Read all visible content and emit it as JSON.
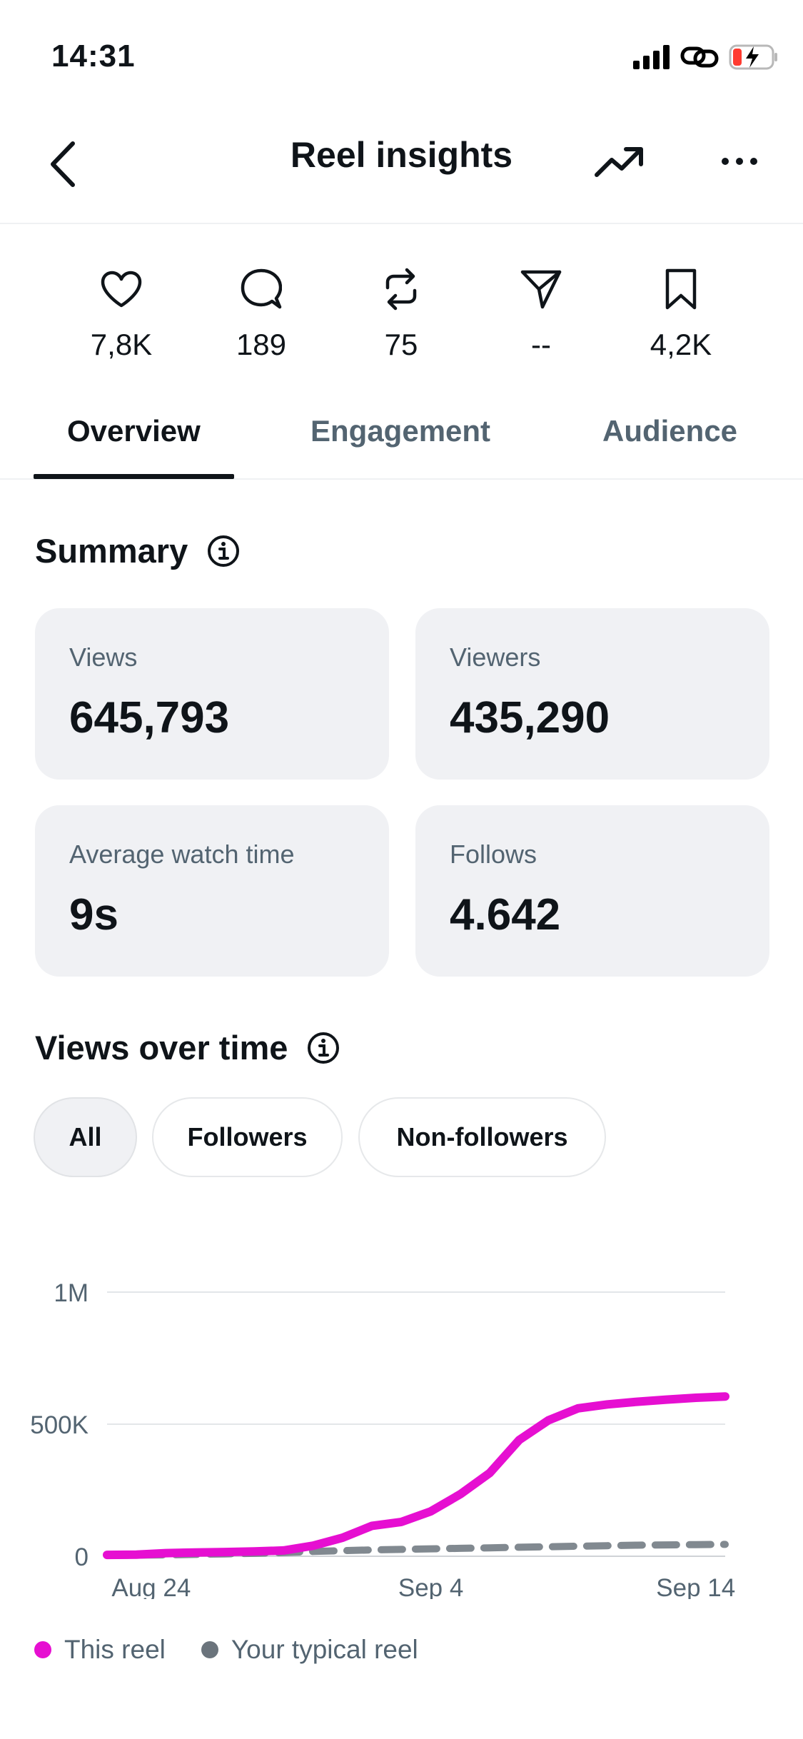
{
  "status_bar": {
    "time": "14:31"
  },
  "header": {
    "title": "Reel insights"
  },
  "stats": [
    {
      "icon": "heart-icon",
      "value": "7,8K"
    },
    {
      "icon": "comment-icon",
      "value": "189"
    },
    {
      "icon": "repost-icon",
      "value": "75"
    },
    {
      "icon": "share-icon",
      "value": "--"
    },
    {
      "icon": "bookmark-icon",
      "value": "4,2K"
    }
  ],
  "tabs": [
    {
      "label": "Overview",
      "active": true
    },
    {
      "label": "Engagement",
      "active": false
    },
    {
      "label": "Audience",
      "active": false
    }
  ],
  "summary": {
    "title": "Summary",
    "cards": [
      {
        "label": "Views",
        "value": "645,793"
      },
      {
        "label": "Viewers",
        "value": "435,290"
      },
      {
        "label": "Average watch time",
        "value": "9s"
      },
      {
        "label": "Follows",
        "value": "4.642"
      }
    ]
  },
  "views_over_time": {
    "title": "Views over time",
    "filters": [
      {
        "label": "All",
        "selected": true
      },
      {
        "label": "Followers",
        "selected": false
      },
      {
        "label": "Non-followers",
        "selected": false
      }
    ]
  },
  "colors": {
    "this_reel": "#e60fd1",
    "typical_reel": "#6b747c",
    "accent": "#0f1419"
  },
  "chart_data": {
    "type": "line",
    "y_tick_labels": [
      "1M",
      "500K",
      "0"
    ],
    "y_ticks": [
      1000000,
      500000,
      0
    ],
    "ylim": [
      0,
      1000000
    ],
    "x_tick_labels": [
      "Aug 24",
      "Sep 4",
      "Sep 14"
    ],
    "xlim": [
      0,
      21
    ],
    "x_tick_positions": [
      1.5,
      11,
      20
    ],
    "grid": true,
    "legend_position": "bottom-left",
    "series": [
      {
        "name": "This reel",
        "style": "solid",
        "x": [
          0,
          1,
          2,
          3,
          4,
          5,
          6,
          7,
          8,
          9,
          10,
          11,
          12,
          13,
          14,
          15,
          16,
          17,
          18,
          19,
          20,
          21
        ],
        "values": [
          5000,
          6000,
          12000,
          14000,
          16000,
          18000,
          22000,
          40000,
          70000,
          115000,
          130000,
          170000,
          235000,
          315000,
          440000,
          515000,
          560000,
          575000,
          585000,
          593000,
          600000,
          605000
        ]
      },
      {
        "name": "Your typical reel",
        "style": "dashed",
        "x": [
          0,
          1,
          2,
          3,
          4,
          5,
          6,
          7,
          8,
          9,
          10,
          11,
          12,
          13,
          14,
          15,
          16,
          17,
          18,
          19,
          20,
          21
        ],
        "values": [
          3000,
          4000,
          5000,
          7000,
          9000,
          11000,
          14000,
          18000,
          21000,
          24000,
          26000,
          28000,
          30000,
          32000,
          34000,
          36000,
          38000,
          40000,
          42000,
          43000,
          44000,
          45000
        ]
      }
    ]
  }
}
